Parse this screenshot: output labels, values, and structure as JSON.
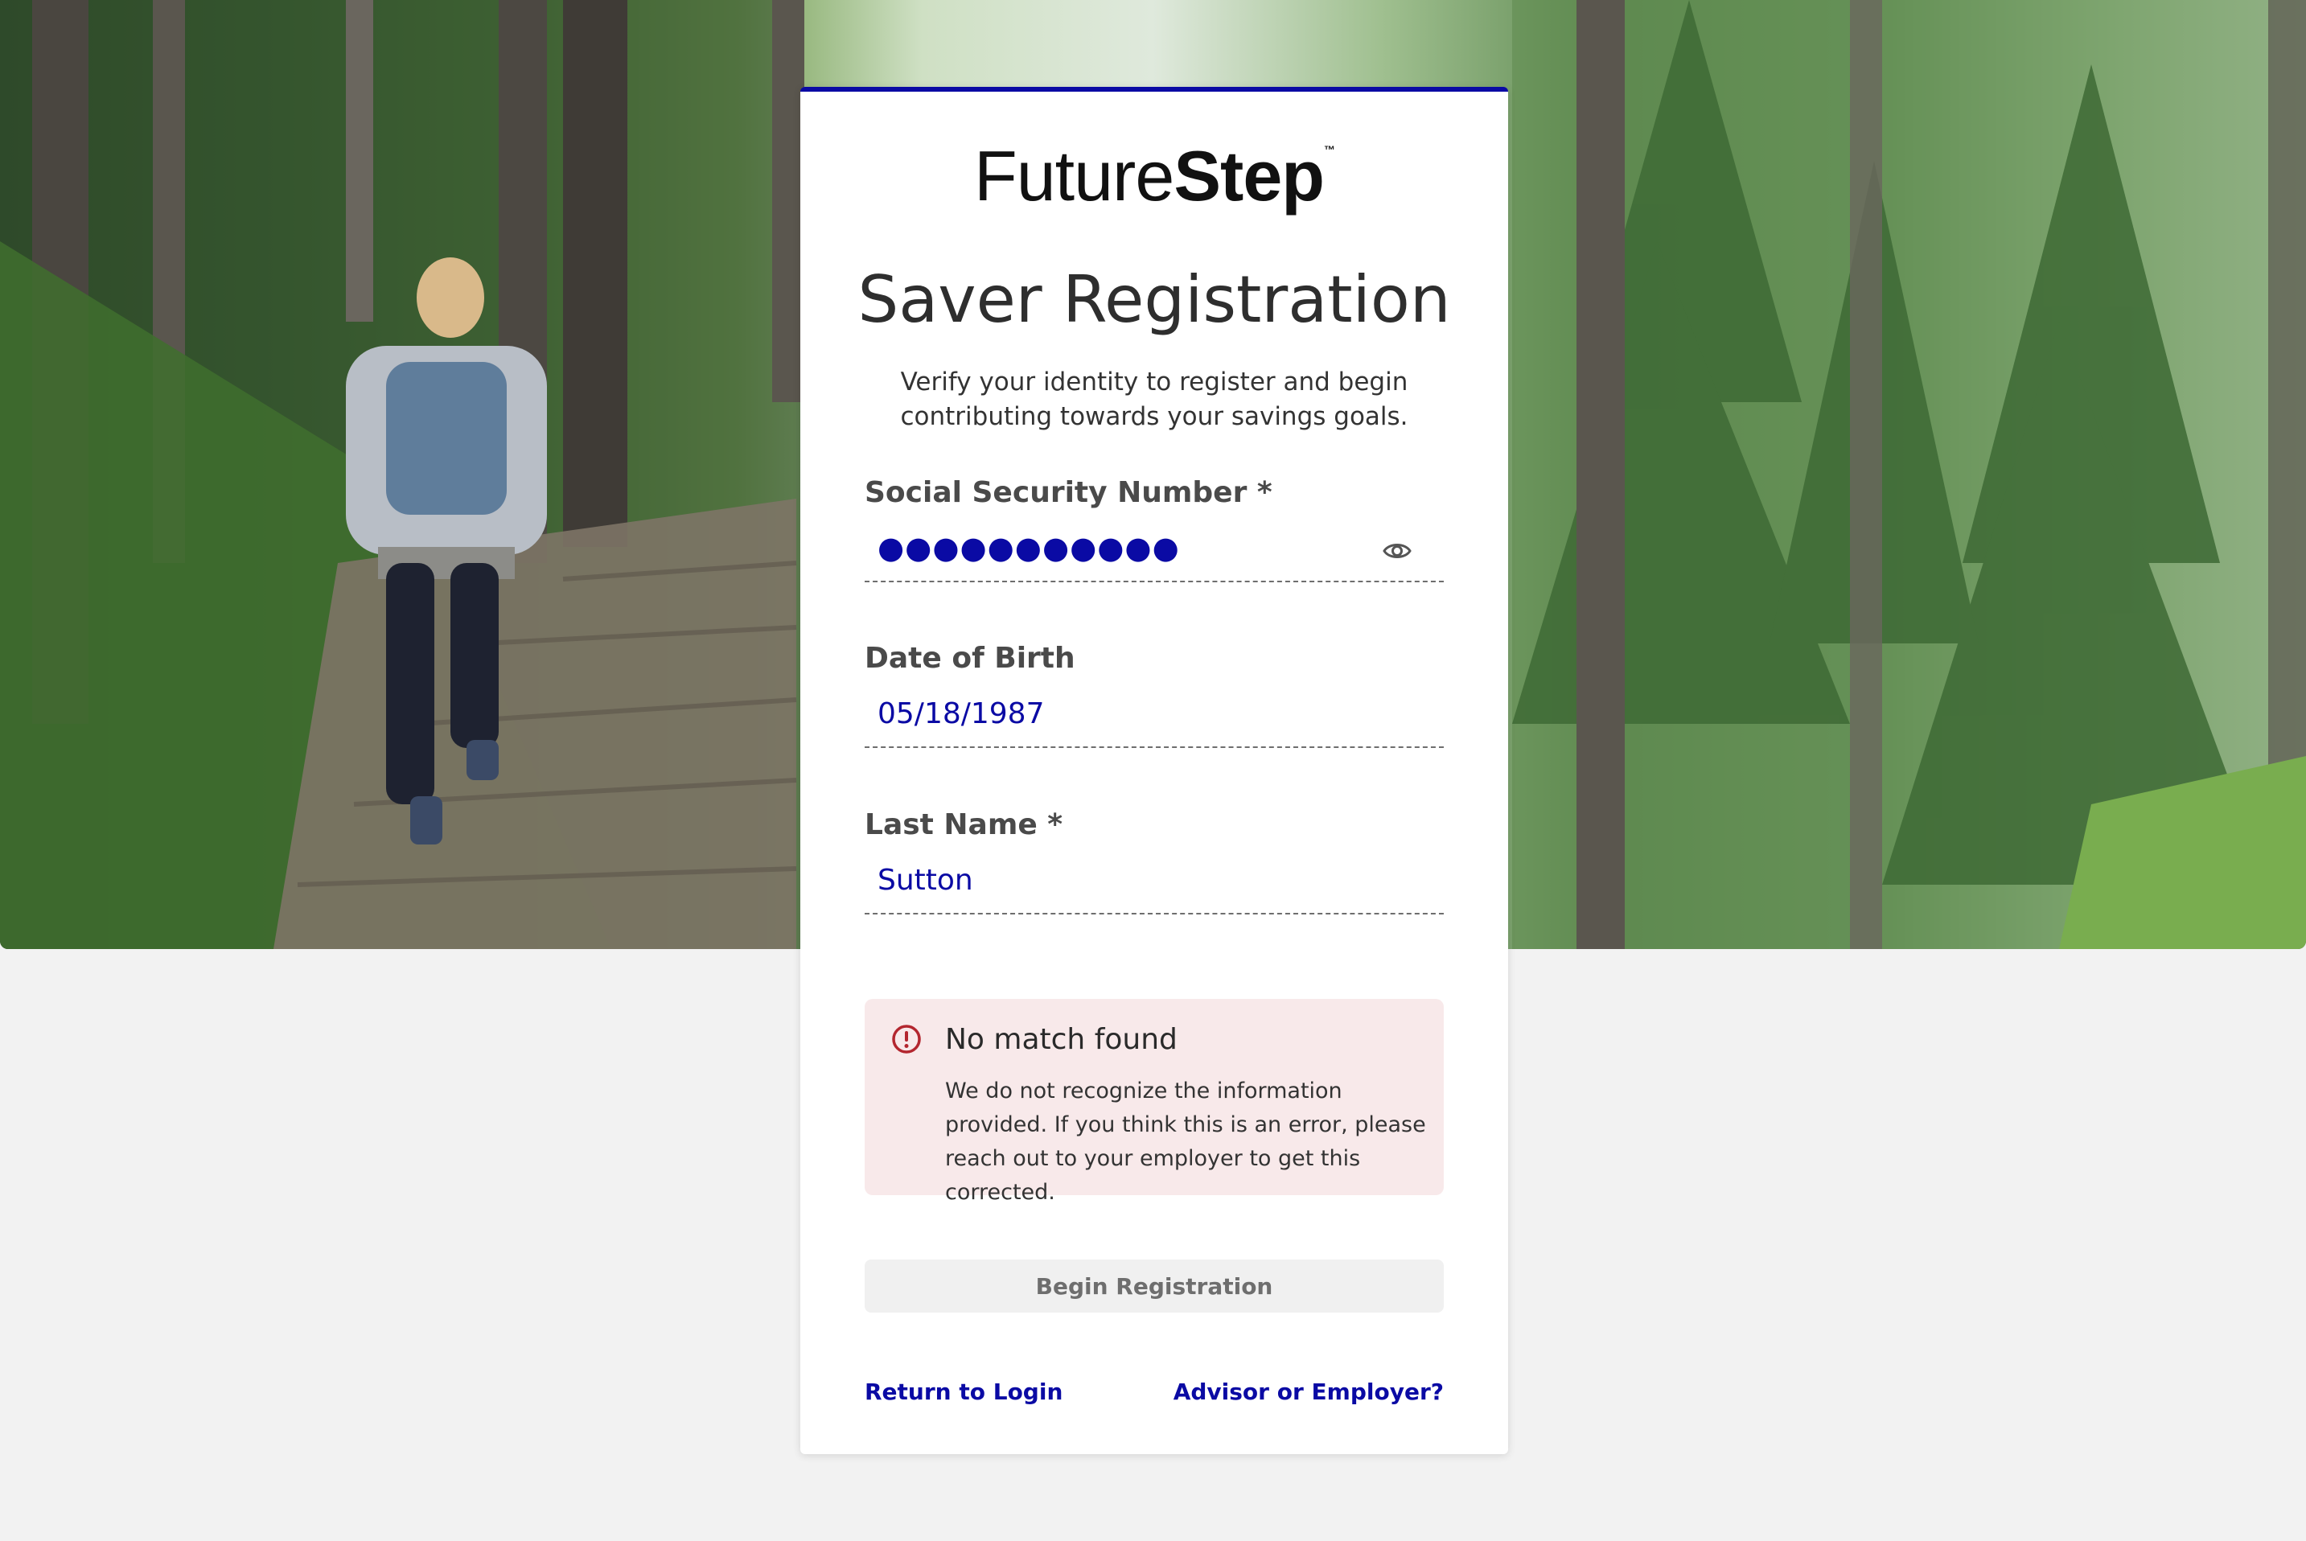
{
  "brand": {
    "logo_regular": "Future",
    "logo_bold": "Step",
    "logo_tm": "™"
  },
  "page": {
    "title": "Saver Registration",
    "subtitle": "Verify your identity to register and begin contributing towards your savings goals."
  },
  "form": {
    "ssn": {
      "label": "Social Security Number *",
      "masked_value": "●●●●●●●●●●●",
      "icon": "eye-icon"
    },
    "dob": {
      "label": "Date of Birth",
      "value": "05/18/1987"
    },
    "last_name": {
      "label": "Last Name *",
      "value": "Sutton"
    }
  },
  "alert": {
    "icon": "exclamation-circle-icon",
    "title": "No match found",
    "body": "We do not recognize the information provided. If you think this is an error, please reach out to your employer to get this corrected."
  },
  "actions": {
    "begin_label": "Begin Registration",
    "return_login": "Return to Login",
    "advisor_employer": "Advisor or Employer?"
  },
  "colors": {
    "accent": "#0a0aa4",
    "alert_bg": "#f8e9ea",
    "alert_icon": "#b3262f",
    "page_bg": "#f2f2f2"
  }
}
